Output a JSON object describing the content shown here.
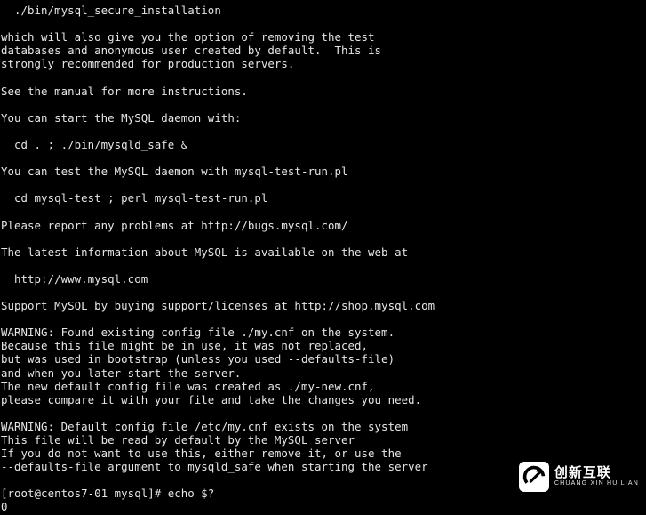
{
  "terminal": {
    "lines": [
      "  ./bin/mysql_secure_installation",
      "",
      "which will also give you the option of removing the test",
      "databases and anonymous user created by default.  This is",
      "strongly recommended for production servers.",
      "",
      "See the manual for more instructions.",
      "",
      "You can start the MySQL daemon with:",
      "",
      "  cd . ; ./bin/mysqld_safe &",
      "",
      "You can test the MySQL daemon with mysql-test-run.pl",
      "",
      "  cd mysql-test ; perl mysql-test-run.pl",
      "",
      "Please report any problems at http://bugs.mysql.com/",
      "",
      "The latest information about MySQL is available on the web at",
      "",
      "  http://www.mysql.com",
      "",
      "Support MySQL by buying support/licenses at http://shop.mysql.com",
      "",
      "WARNING: Found existing config file ./my.cnf on the system.",
      "Because this file might be in use, it was not replaced,",
      "but was used in bootstrap (unless you used --defaults-file)",
      "and when you later start the server.",
      "The new default config file was created as ./my-new.cnf,",
      "please compare it with your file and take the changes you need.",
      "",
      "WARNING: Default config file /etc/my.cnf exists on the system",
      "This file will be read by default by the MySQL server",
      "If you do not want to use this, either remove it, or use the",
      "--defaults-file argument to mysqld_safe when starting the server",
      "",
      "[root@centos7-01 mysql]# echo $?",
      "0"
    ]
  },
  "watermark": {
    "brand_cn": "创新互联",
    "brand_en": "CHUANG XIN HU LIAN"
  }
}
